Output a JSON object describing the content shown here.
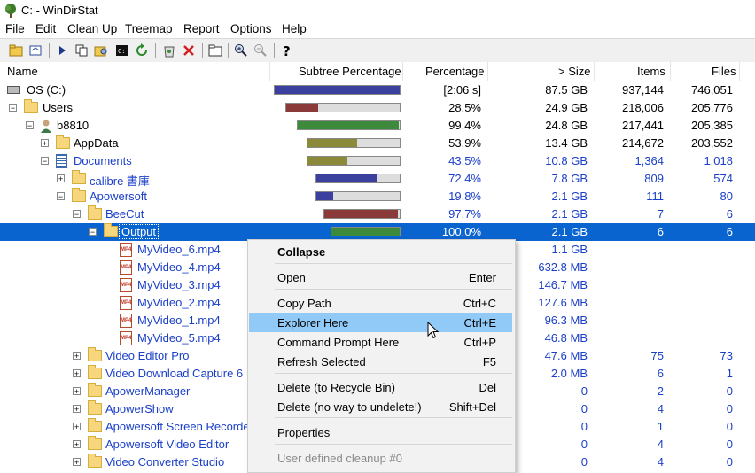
{
  "window": {
    "title": "C: - WinDirStat"
  },
  "menu": [
    "File",
    "Edit",
    "Clean Up",
    "Treemap",
    "Report",
    "Options",
    "Help"
  ],
  "columns": {
    "name": "Name",
    "subtree": "Subtree Percentage",
    "percentage": "Percentage",
    "size": "> Size",
    "items": "Items",
    "files": "Files"
  },
  "colors": {
    "selection": "#0a64d0",
    "link": "#1a3fc8",
    "menu_highlight": "#91c9f7"
  },
  "rows": [
    {
      "name": "OS (C:)",
      "pct": "[2:06 s]",
      "size": "87.5 GB",
      "items": "937,144",
      "files": "746,051",
      "bar": 1.0,
      "barcolor": "#3b3f9e",
      "blue": false
    },
    {
      "name": "Users",
      "pct": "28.5%",
      "size": "24.9 GB",
      "items": "218,006",
      "files": "205,776",
      "bar": 0.285,
      "barcolor": "#8b3a3a",
      "blue": false
    },
    {
      "name": "b8810",
      "pct": "99.4%",
      "size": "24.8 GB",
      "items": "217,441",
      "files": "205,385",
      "bar": 0.994,
      "barcolor": "#3d8a3d",
      "blue": false
    },
    {
      "name": "AppData",
      "pct": "53.9%",
      "size": "13.4 GB",
      "items": "214,672",
      "files": "203,552",
      "bar": 0.539,
      "barcolor": "#8a8a3a",
      "blue": false
    },
    {
      "name": "Documents",
      "pct": "43.5%",
      "size": "10.8 GB",
      "items": "1,364",
      "files": "1,018",
      "bar": 0.435,
      "barcolor": "#8a8a3a",
      "blue": true
    },
    {
      "name": "calibre 書庫",
      "pct": "72.4%",
      "size": "7.8 GB",
      "items": "809",
      "files": "574",
      "bar": 0.724,
      "barcolor": "#3b3f9e",
      "blue": true
    },
    {
      "name": "Apowersoft",
      "pct": "19.8%",
      "size": "2.1 GB",
      "items": "111",
      "files": "80",
      "bar": 0.198,
      "barcolor": "#3b3f9e",
      "blue": true
    },
    {
      "name": "BeeCut",
      "pct": "97.7%",
      "size": "2.1 GB",
      "items": "7",
      "files": "6",
      "bar": 0.977,
      "barcolor": "#8b3a3a",
      "blue": true
    },
    {
      "name": "Output",
      "pct": "100.0%",
      "size": "2.1 GB",
      "items": "6",
      "files": "6",
      "bar": 1.0,
      "barcolor": "#3d8a3d",
      "blue": true
    },
    {
      "name": "MyVideo_6.mp4",
      "pct": "",
      "size": "1.1 GB",
      "items": "",
      "files": "",
      "bar": null,
      "blue": true
    },
    {
      "name": "MyVideo_4.mp4",
      "pct": "",
      "size": "632.8 MB",
      "items": "",
      "files": "",
      "bar": null,
      "blue": true
    },
    {
      "name": "MyVideo_3.mp4",
      "pct": "",
      "size": "146.7 MB",
      "items": "",
      "files": "",
      "bar": null,
      "blue": true
    },
    {
      "name": "MyVideo_2.mp4",
      "pct": "",
      "size": "127.6 MB",
      "items": "",
      "files": "",
      "bar": null,
      "blue": true
    },
    {
      "name": "MyVideo_1.mp4",
      "pct": "",
      "size": "96.3 MB",
      "items": "",
      "files": "",
      "bar": null,
      "blue": true
    },
    {
      "name": "MyVideo_5.mp4",
      "pct": "",
      "size": "46.8 MB",
      "items": "",
      "files": "",
      "bar": null,
      "blue": true
    },
    {
      "name": "Video Editor Pro",
      "pct": "",
      "size": "47.6 MB",
      "items": "75",
      "files": "73",
      "bar": null,
      "blue": true
    },
    {
      "name": "Video Download Capture 6",
      "pct": "",
      "size": "2.0 MB",
      "items": "6",
      "files": "1",
      "bar": null,
      "blue": true
    },
    {
      "name": "ApowerManager",
      "pct": "",
      "size": "0",
      "items": "2",
      "files": "0",
      "bar": null,
      "blue": true
    },
    {
      "name": "ApowerShow",
      "pct": "",
      "size": "0",
      "items": "4",
      "files": "0",
      "bar": null,
      "blue": true
    },
    {
      "name": "Apowersoft Screen Recorde",
      "pct": "",
      "size": "0",
      "items": "1",
      "files": "0",
      "bar": null,
      "blue": true
    },
    {
      "name": "Apowersoft Video Editor",
      "pct": "",
      "size": "0",
      "items": "4",
      "files": "0",
      "bar": null,
      "blue": true
    },
    {
      "name": "Video Converter Studio",
      "pct": "",
      "size": "0",
      "items": "4",
      "files": "0",
      "bar": null,
      "blue": true
    }
  ],
  "context_menu": [
    {
      "label": "Collapse",
      "shortcut": "",
      "bold": true
    },
    {
      "label": "Open",
      "shortcut": "Enter"
    },
    {
      "label": "Copy Path",
      "shortcut": "Ctrl+C"
    },
    {
      "label": "Explorer Here",
      "shortcut": "Ctrl+E",
      "highlight": true
    },
    {
      "label": "Command Prompt Here",
      "shortcut": "Ctrl+P"
    },
    {
      "label": "Refresh Selected",
      "shortcut": "F5"
    },
    {
      "label": "Delete (to Recycle Bin)",
      "shortcut": "Del"
    },
    {
      "label": "Delete (no way to undelete!)",
      "shortcut": "Shift+Del"
    },
    {
      "label": "Properties",
      "shortcut": ""
    },
    {
      "label": "User defined cleanup #0",
      "shortcut": "",
      "disabled": true
    }
  ]
}
